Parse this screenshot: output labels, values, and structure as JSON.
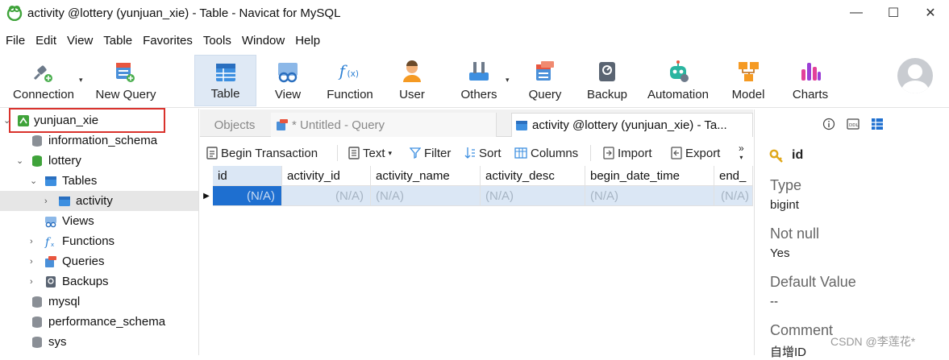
{
  "window": {
    "title": "activity @lottery (yunjuan_xie) - Table - Navicat for MySQL",
    "minimize": "—",
    "maximize": "☐",
    "close": "✕"
  },
  "menu": [
    "File",
    "Edit",
    "View",
    "Table",
    "Favorites",
    "Tools",
    "Window",
    "Help"
  ],
  "toolbar": {
    "connection": "Connection",
    "new_query": "New Query",
    "table": "Table",
    "view": "View",
    "function": "Function",
    "user": "User",
    "others": "Others",
    "query": "Query",
    "backup": "Backup",
    "automation": "Automation",
    "model": "Model",
    "charts": "Charts"
  },
  "sidebar": {
    "connection": "yunjuan_xie",
    "items": [
      {
        "label": "information_schema"
      },
      {
        "label": "lottery"
      },
      {
        "label": "Tables"
      },
      {
        "label": "activity"
      },
      {
        "label": "Views"
      },
      {
        "label": "Functions"
      },
      {
        "label": "Queries"
      },
      {
        "label": "Backups"
      },
      {
        "label": "mysql"
      },
      {
        "label": "performance_schema"
      },
      {
        "label": "sys"
      }
    ]
  },
  "tabs": {
    "objects": "Objects",
    "query": "* Untitled - Query",
    "active": "activity @lottery (yunjuan_xie) - Ta..."
  },
  "subtoolbar": {
    "begin_transaction": "Begin Transaction",
    "text": "Text",
    "filter": "Filter",
    "sort": "Sort",
    "columns": "Columns",
    "import": "Import",
    "export": "Export",
    "more": "»"
  },
  "grid": {
    "columns": [
      "id",
      "activity_id",
      "activity_name",
      "activity_desc",
      "begin_date_time",
      "end_"
    ],
    "row": [
      "(N/A)",
      "(N/A)",
      "(N/A)",
      "(N/A)",
      "(N/A)",
      "(N/A)"
    ]
  },
  "details": {
    "field": "id",
    "type_label": "Type",
    "type_value": "bigint",
    "notnull_label": "Not null",
    "notnull_value": "Yes",
    "default_label": "Default Value",
    "default_value": "--",
    "comment_label": "Comment",
    "comment_value": "自增ID"
  },
  "watermark": "CSDN @李莲花*",
  "colors": {
    "accent": "#1e6fd0",
    "selection": "#dbe7f5",
    "highlight_border": "#d9322c"
  }
}
